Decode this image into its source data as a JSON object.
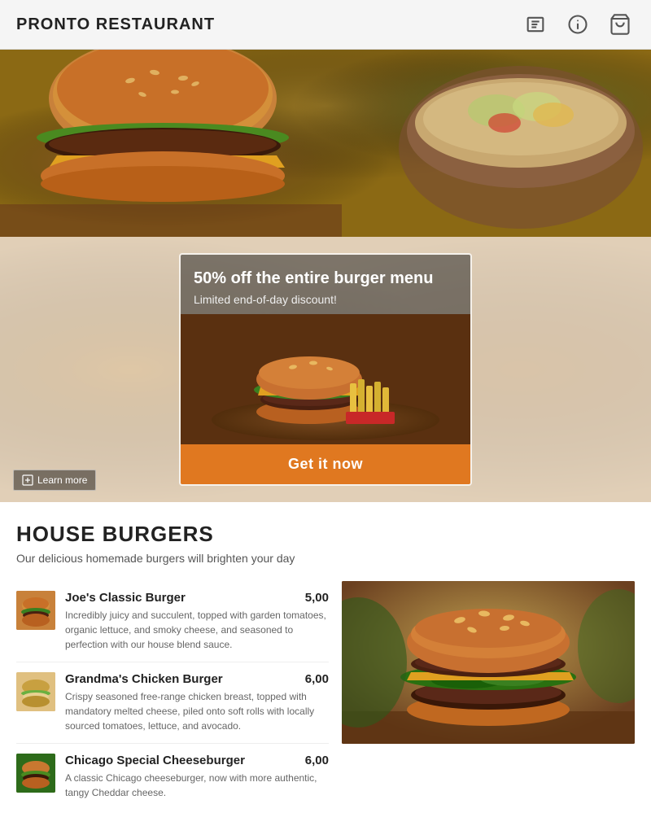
{
  "header": {
    "title": "PRONTO RESTAURANT",
    "icons": {
      "menu": "menu-icon",
      "info": "info-icon",
      "cart": "cart-icon"
    }
  },
  "banner": {
    "headline": "50% off the entire burger menu",
    "subtitle": "Limited end-of-day discount!",
    "cta_label": "Get it now",
    "learn_more_label": "Learn more"
  },
  "section": {
    "title": "HOUSE BURGERS",
    "description": "Our delicious homemade burgers will brighten your day"
  },
  "menu_items": [
    {
      "name": "Joe's Classic Burger",
      "price": "5,00",
      "description": "Incredibly juicy and succulent, topped with garden tomatoes, organic lettuce, and smoky cheese, and seasoned to perfection with our house blend sauce.",
      "thumb_class": "thumb-classic"
    },
    {
      "name": "Grandma's Chicken Burger",
      "price": "6,00",
      "description": "Crispy seasoned free-range chicken breast, topped with mandatory melted cheese, piled onto soft rolls with locally sourced tomatoes, lettuce, and avocado.",
      "thumb_class": "thumb-chicken"
    },
    {
      "name": "Chicago Special Cheeseburger",
      "price": "6,00",
      "description": "A classic Chicago cheeseburger, now with more authentic, tangy Cheddar cheese.",
      "thumb_class": "thumb-chicago"
    }
  ]
}
